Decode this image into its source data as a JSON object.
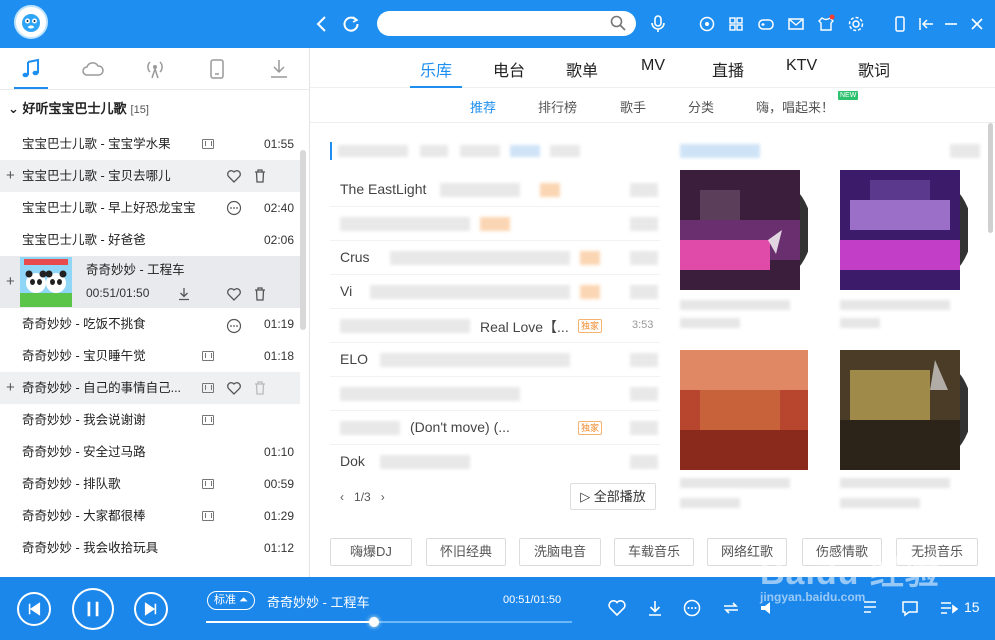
{
  "search": {
    "placeholder": "",
    "value": ""
  },
  "left_tabs": [
    "music-note-icon",
    "cloud-icon",
    "radio-icon",
    "device-icon",
    "download-icon"
  ],
  "playlist": {
    "title": "好听宝宝巴士儿歌",
    "count": "[15]"
  },
  "songs": [
    {
      "title": "宝宝巴士儿歌 - 宝宝学水果",
      "duration": "01:55",
      "mv": true
    },
    {
      "title": "宝宝巴士儿歌 - 宝贝去哪儿",
      "duration": "",
      "mv": false
    },
    {
      "title": "宝宝巴士儿歌 - 早上好恐龙宝宝",
      "duration": "02:40",
      "mv": false
    },
    {
      "title": "宝宝巴士儿歌 - 好爸爸",
      "duration": "02:06",
      "mv": false
    },
    {
      "title": "奇奇妙妙 - 工程车",
      "duration": "",
      "progress_text": "00:51/01:50",
      "playing": true
    },
    {
      "title": "奇奇妙妙 - 吃饭不挑食",
      "duration": "01:19",
      "mv": false
    },
    {
      "title": "奇奇妙妙 - 宝贝睡午觉",
      "duration": "01:18",
      "mv": true
    },
    {
      "title": "奇奇妙妙 - 自己的事情自己...",
      "duration": "",
      "mv": true
    },
    {
      "title": "奇奇妙妙 - 我会说谢谢",
      "duration": "",
      "mv": true
    },
    {
      "title": "奇奇妙妙 - 安全过马路",
      "duration": "01:10",
      "mv": false
    },
    {
      "title": "奇奇妙妙 - 排队歌",
      "duration": "00:59",
      "mv": true
    },
    {
      "title": "奇奇妙妙 - 大家都很棒",
      "duration": "01:29",
      "mv": true
    },
    {
      "title": "奇奇妙妙 - 我会收拾玩具",
      "duration": "01:12",
      "mv": false
    }
  ],
  "nav_tabs": [
    "乐库",
    "电台",
    "歌单",
    "MV",
    "直播",
    "KTV",
    "歌词"
  ],
  "sub_tabs": [
    "推荐",
    "排行榜",
    "歌手",
    "分类",
    "嗨，唱起来！"
  ],
  "new_badge": "NEW",
  "new_songs": {
    "rows": [
      {
        "text": "The EastLight",
        "tag": ""
      },
      {
        "text": "",
        "tag": ""
      },
      {
        "text": "Crus",
        "tag": ""
      },
      {
        "text": "Vi",
        "tag": ""
      },
      {
        "text": "Real Love【...",
        "tag": "独家"
      },
      {
        "text": "ELO",
        "tag": ""
      },
      {
        "text": "",
        "tag": ""
      },
      {
        "text": "(Don't move) (...",
        "tag": "独家"
      },
      {
        "text": "Dok",
        "tag": ""
      }
    ],
    "page": "1/3",
    "play_all": "全部播放",
    "duration_snippet": "3:53"
  },
  "categories": [
    "嗨爆DJ",
    "怀旧经典",
    "洗脑电音",
    "车载音乐",
    "网络红歌",
    "伤感情歌",
    "无损音乐"
  ],
  "player": {
    "quality": "标准",
    "now_title": "奇奇妙妙 - 工程车",
    "time": "00:51/01:50",
    "progress": 0.46,
    "list_count": "15"
  },
  "watermark": {
    "main": "Baidu 经验",
    "sub": "jingyan.baidu.com"
  },
  "colors": {
    "accent": "#1e8ff0",
    "player": "#1c87eb"
  }
}
